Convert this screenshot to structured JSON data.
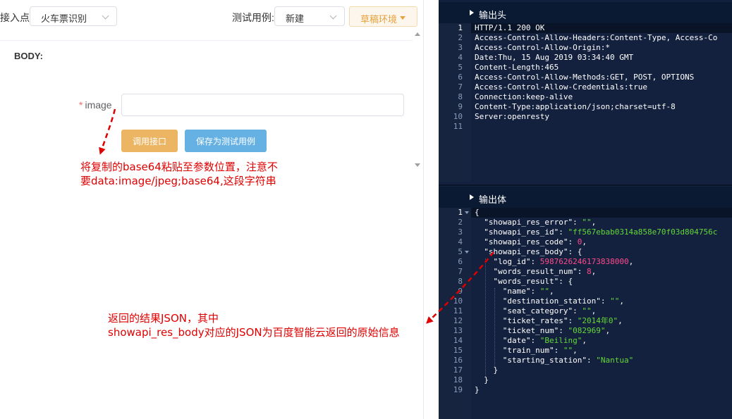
{
  "toolbar": {
    "entry_label": "接入点:",
    "entry_value": "火车票识别",
    "case_label": "测试用例:",
    "case_value": "新建",
    "env_label": "草稿环境"
  },
  "form": {
    "section_label": "BODY:",
    "image_label": "image",
    "required_mark": "*",
    "image_value": "",
    "call_button": "调用接口",
    "save_button": "保存为测试用例"
  },
  "annotations": {
    "note1_line1": "将复制的base64粘贴至参数位置，注意不",
    "note1_line2": "要data:image/jpeg;base64,这段字符串",
    "note2_line1": "返回的结果JSON，其中",
    "note2_line2": "showapi_res_body对应的JSON为百度智能云返回的原始信息"
  },
  "colors": {
    "annotation": "#e00000",
    "panel_bg": "#14213e",
    "string": "#62d838",
    "number": "#ff4a8b"
  },
  "response": {
    "headers_title": "输出头",
    "body_title": "输出体",
    "headers_lines": [
      "HTTP/1.1 200 OK",
      "Access-Control-Allow-Headers:Content-Type, Access-Co",
      "Access-Control-Allow-Origin:*",
      "Date:Thu, 15 Aug 2019 03:34:40 GMT",
      "Content-Length:465",
      "Access-Control-Allow-Methods:GET, POST, OPTIONS",
      "Access-Control-Allow-Credentials:true",
      "Connection:keep-alive",
      "Content-Type:application/json;charset=utf-8",
      "Server:openresty",
      ""
    ],
    "body_lines": [
      {
        "indent": 0,
        "fold": true,
        "parts": [
          [
            "p",
            "{"
          ]
        ]
      },
      {
        "indent": 1,
        "parts": [
          [
            "k",
            "\"showapi_res_error\""
          ],
          [
            "p",
            ": "
          ],
          [
            "s",
            "\"\""
          ],
          [
            "p",
            ","
          ]
        ]
      },
      {
        "indent": 1,
        "parts": [
          [
            "k",
            "\"showapi_res_id\""
          ],
          [
            "p",
            ": "
          ],
          [
            "s",
            "\"ff567ebab0314a858e70f03d804756c"
          ]
        ]
      },
      {
        "indent": 1,
        "parts": [
          [
            "k",
            "\"showapi_res_code\""
          ],
          [
            "p",
            ": "
          ],
          [
            "n",
            "0"
          ],
          [
            "p",
            ","
          ]
        ]
      },
      {
        "indent": 1,
        "fold": true,
        "parts": [
          [
            "k",
            "\"showapi_res_body\""
          ],
          [
            "p",
            ": {"
          ]
        ]
      },
      {
        "indent": 2,
        "parts": [
          [
            "k",
            "\"log_id\""
          ],
          [
            "p",
            ": "
          ],
          [
            "n",
            "5987626246173838000"
          ],
          [
            "p",
            ","
          ]
        ]
      },
      {
        "indent": 2,
        "parts": [
          [
            "k",
            "\"words_result_num\""
          ],
          [
            "p",
            ": "
          ],
          [
            "n",
            "8"
          ],
          [
            "p",
            ","
          ]
        ]
      },
      {
        "indent": 2,
        "parts": [
          [
            "k",
            "\"words_result\""
          ],
          [
            "p",
            ": {"
          ]
        ]
      },
      {
        "indent": 3,
        "parts": [
          [
            "k",
            "\"name\""
          ],
          [
            "p",
            ": "
          ],
          [
            "s",
            "\"\""
          ],
          [
            "p",
            ","
          ]
        ]
      },
      {
        "indent": 3,
        "parts": [
          [
            "k",
            "\"destination_station\""
          ],
          [
            "p",
            ": "
          ],
          [
            "s",
            "\"\""
          ],
          [
            "p",
            ","
          ]
        ]
      },
      {
        "indent": 3,
        "parts": [
          [
            "k",
            "\"seat_category\""
          ],
          [
            "p",
            ": "
          ],
          [
            "s",
            "\"\""
          ],
          [
            "p",
            ","
          ]
        ]
      },
      {
        "indent": 3,
        "parts": [
          [
            "k",
            "\"ticket_rates\""
          ],
          [
            "p",
            ": "
          ],
          [
            "s",
            "\"2014年0\""
          ],
          [
            "p",
            ","
          ]
        ]
      },
      {
        "indent": 3,
        "parts": [
          [
            "k",
            "\"ticket_num\""
          ],
          [
            "p",
            ": "
          ],
          [
            "s",
            "\"082969\""
          ],
          [
            "p",
            ","
          ]
        ]
      },
      {
        "indent": 3,
        "parts": [
          [
            "k",
            "\"date\""
          ],
          [
            "p",
            ": "
          ],
          [
            "s",
            "\"Beiling\""
          ],
          [
            "p",
            ","
          ]
        ]
      },
      {
        "indent": 3,
        "parts": [
          [
            "k",
            "\"train_num\""
          ],
          [
            "p",
            ": "
          ],
          [
            "s",
            "\"\""
          ],
          [
            "p",
            ","
          ]
        ]
      },
      {
        "indent": 3,
        "parts": [
          [
            "k",
            "\"starting_station\""
          ],
          [
            "p",
            ": "
          ],
          [
            "s",
            "\"Nantua\""
          ]
        ]
      },
      {
        "indent": 2,
        "parts": [
          [
            "p",
            "}"
          ]
        ]
      },
      {
        "indent": 1,
        "parts": [
          [
            "p",
            "}"
          ]
        ]
      },
      {
        "indent": 0,
        "parts": [
          [
            "p",
            "}"
          ]
        ]
      }
    ]
  }
}
